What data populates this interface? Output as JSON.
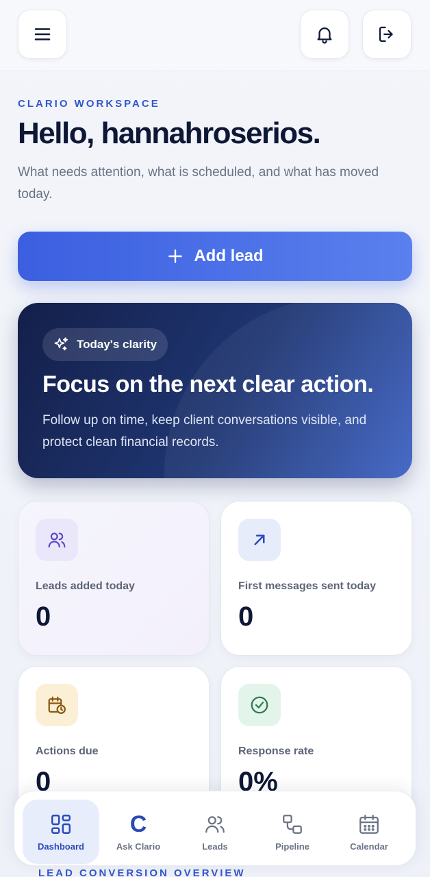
{
  "header": {
    "eyebrow": "CLARIO WORKSPACE",
    "greeting": "Hello, hannahroserios.",
    "subtitle": "What needs attention, what is scheduled, and what has moved today."
  },
  "actions": {
    "add_lead_label": "Add lead"
  },
  "hero": {
    "pill_label": "Today's clarity",
    "title": "Focus on the next clear action.",
    "text": "Follow up on time, keep client conversations visible, and protect clean financial records."
  },
  "stats": [
    {
      "label": "Leads added today",
      "value": "0",
      "icon": "users-icon"
    },
    {
      "label": "First messages sent today",
      "value": "0",
      "icon": "arrow-up-right-icon"
    },
    {
      "label": "Actions due",
      "value": "0",
      "icon": "calendar-clock-icon"
    },
    {
      "label": "Response rate",
      "value": "0%",
      "icon": "check-circle-icon"
    }
  ],
  "next_section": {
    "title": "LEAD CONVERSION OVERVIEW"
  },
  "nav": {
    "items": [
      {
        "label": "Dashboard",
        "icon": "dashboard-icon",
        "active": true
      },
      {
        "label": "Ask Clario",
        "icon": "clario-c-icon",
        "active": false
      },
      {
        "label": "Leads",
        "icon": "users-icon",
        "active": false
      },
      {
        "label": "Pipeline",
        "icon": "pipeline-icon",
        "active": false
      },
      {
        "label": "Calendar",
        "icon": "calendar-icon",
        "active": false
      }
    ]
  },
  "colors": {
    "accent": "#3b5fe0",
    "hero_dark": "#141f4a",
    "text_dark": "#0e1836"
  }
}
